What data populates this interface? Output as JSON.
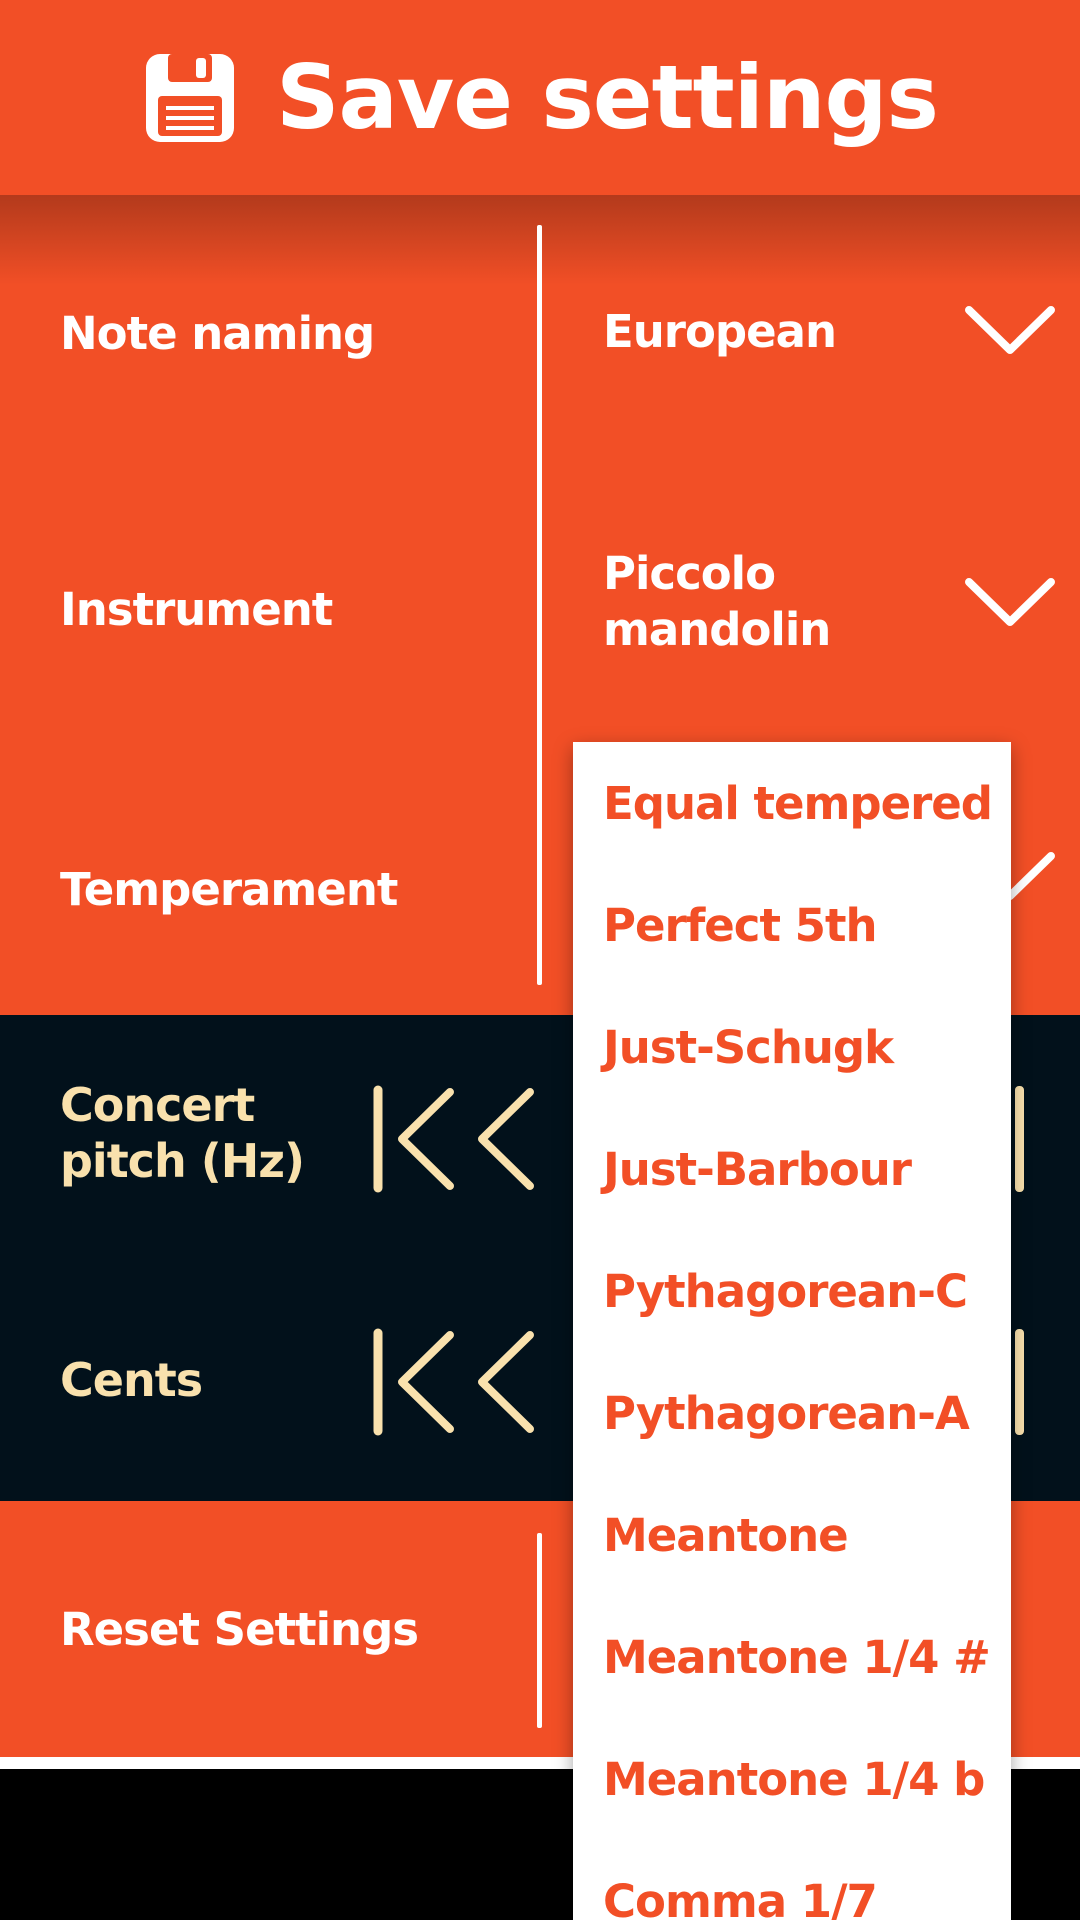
{
  "header": {
    "title": "Save settings",
    "icon": "floppy-disk-icon"
  },
  "settings": {
    "note_naming": {
      "label": "Note naming",
      "value": "European"
    },
    "instrument": {
      "label": "Instrument",
      "value_line1": "Piccolo",
      "value_line2": "mandolin"
    },
    "temperament": {
      "label": "Temperament"
    },
    "concert_pitch": {
      "label_line1": "Concert",
      "label_line2": "pitch (Hz)"
    },
    "cents": {
      "label": "Cents"
    },
    "reset": {
      "label": "Reset Settings"
    }
  },
  "temperament_options": [
    "Equal tempered",
    "Perfect 5th",
    "Just-Schugk",
    "Just-Barbour",
    "Pythagorean-C",
    "Pythagorean-A",
    "Meantone",
    "Meantone 1/4 #",
    "Meantone 1/4 b",
    "Comma 1/7"
  ],
  "colors": {
    "accent": "#f24f26",
    "dark": "#02111b",
    "cream": "#f9e1ad"
  }
}
